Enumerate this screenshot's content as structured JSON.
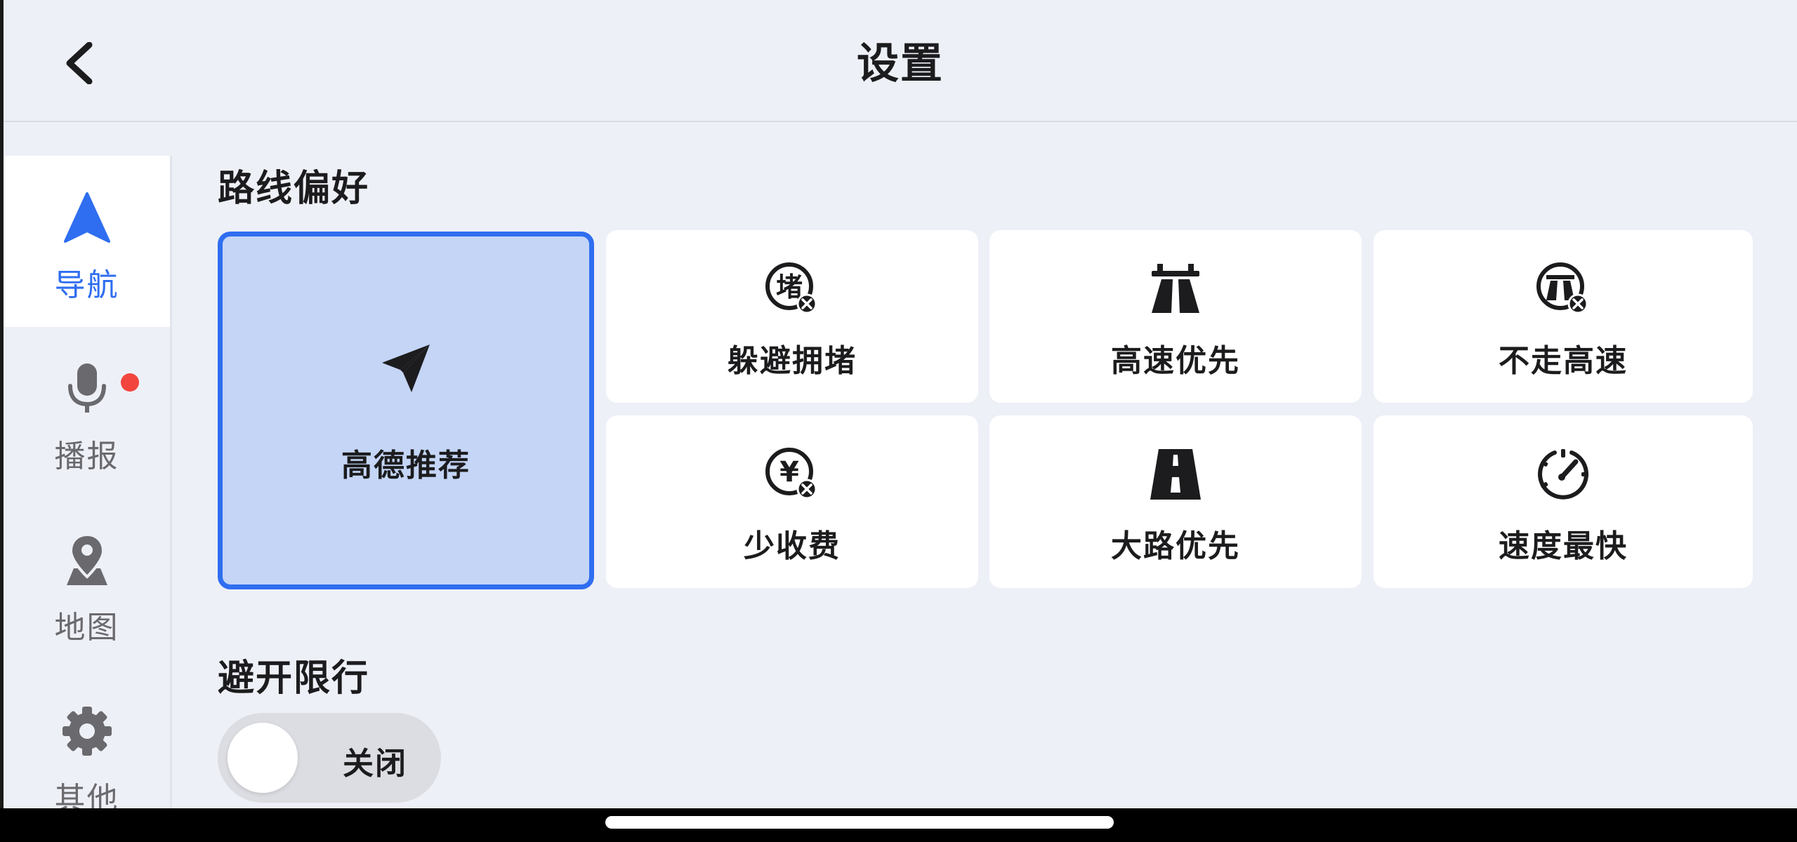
{
  "header": {
    "title": "设置",
    "back_icon": "chevron-left-icon"
  },
  "sidebar": {
    "items": [
      {
        "label": "导航",
        "icon": "navigation-arrow-icon",
        "active": true
      },
      {
        "label": "播报",
        "icon": "microphone-icon",
        "active": false
      },
      {
        "label": "地图",
        "icon": "map-pin-icon",
        "active": false,
        "badge": "red-dot"
      },
      {
        "label": "其他",
        "icon": "gear-icon",
        "active": false
      }
    ]
  },
  "route_preference": {
    "title": "路线偏好",
    "options": [
      {
        "label": "高德推荐",
        "icon": "paper-plane-icon",
        "selected": true
      },
      {
        "label": "躲避拥堵",
        "icon": "avoid-congestion-icon",
        "selected": false
      },
      {
        "label": "高速优先",
        "icon": "highway-icon",
        "selected": false
      },
      {
        "label": "不走高速",
        "icon": "no-highway-icon",
        "selected": false
      },
      {
        "label": "少收费",
        "icon": "avoid-toll-icon",
        "selected": false
      },
      {
        "label": "大路优先",
        "icon": "main-road-icon",
        "selected": false
      },
      {
        "label": "速度最快",
        "icon": "speedometer-icon",
        "selected": false
      }
    ]
  },
  "restriction": {
    "title": "避开限行",
    "toggle_label": "关闭",
    "enabled": false
  },
  "icon_glyphs": {
    "congestion": "堵",
    "yen": "¥"
  },
  "colors": {
    "accent": "#2f6ef0",
    "selected_card_bg": "#c4d5f6",
    "badge": "#f2453d",
    "background": "#eef0f7"
  }
}
